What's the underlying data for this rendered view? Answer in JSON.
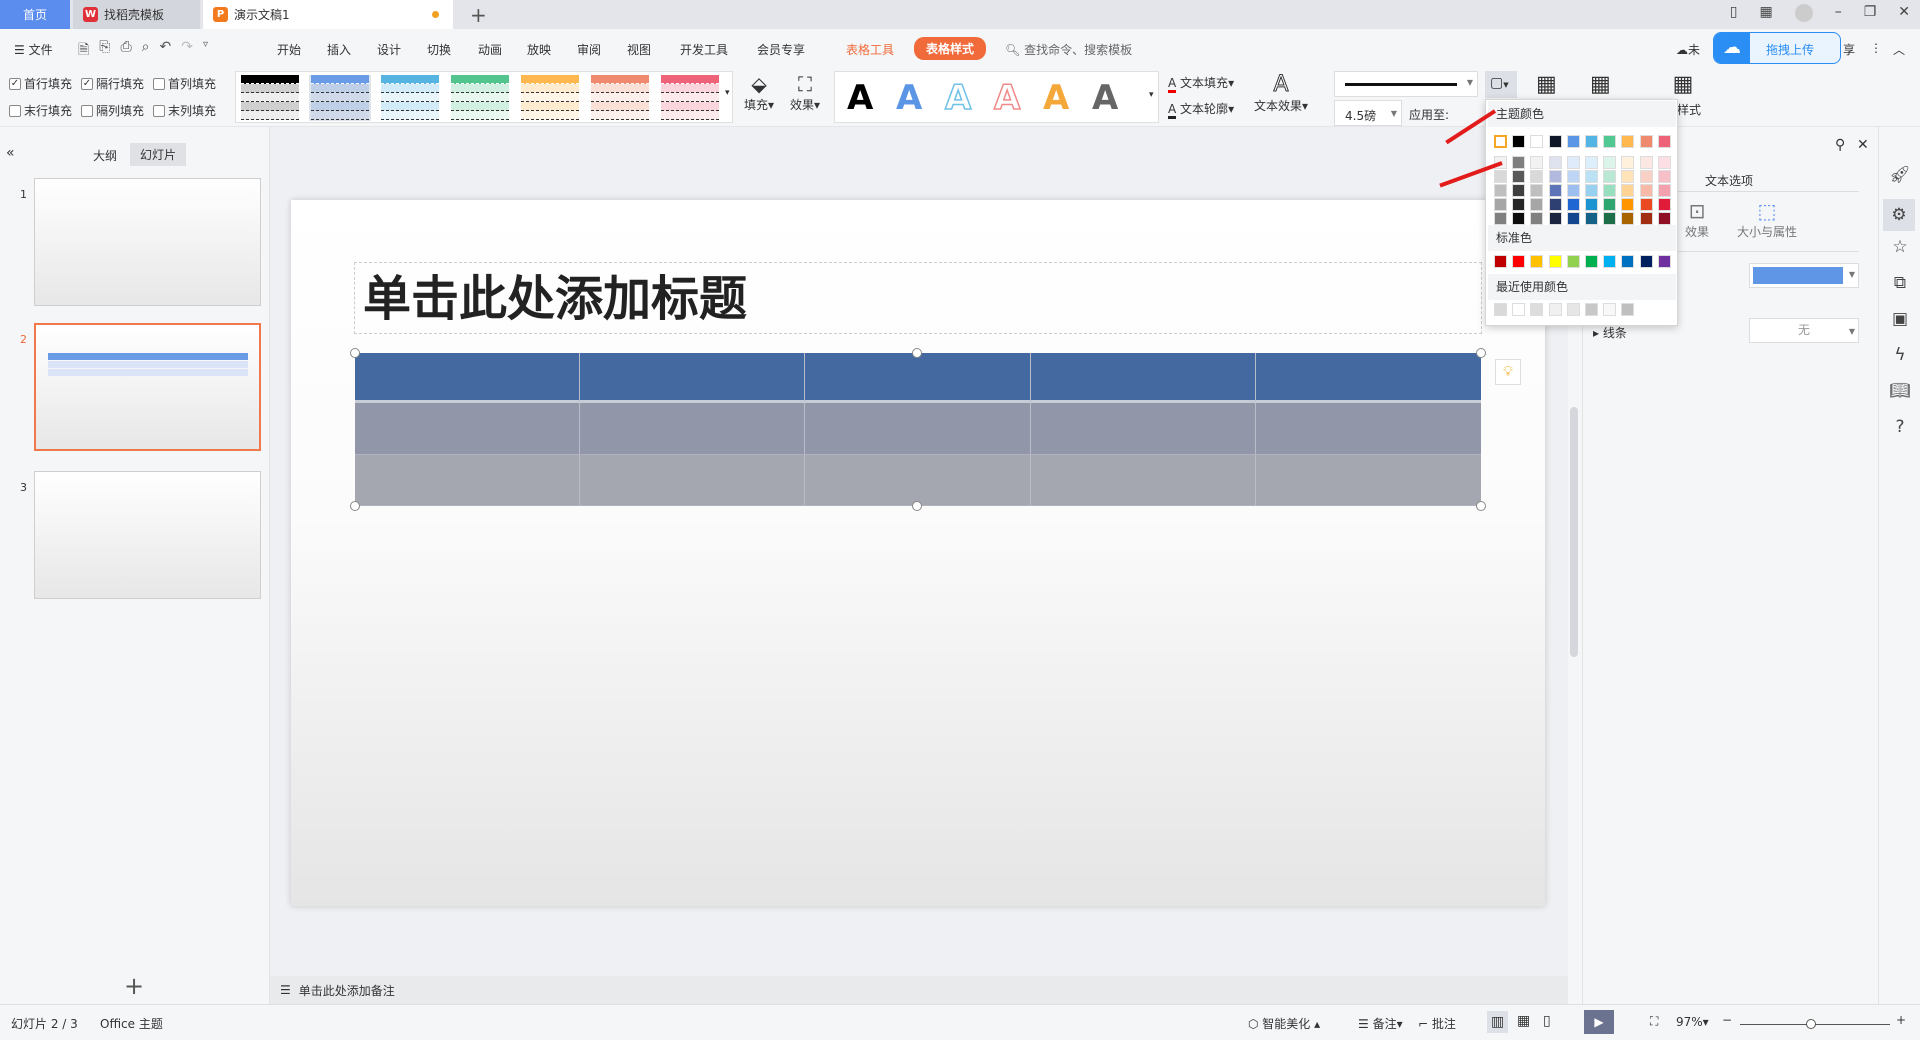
{
  "tabs": [
    {
      "label": "首页",
      "active": false
    },
    {
      "label": "找稻壳模板",
      "icon": "docer-icon"
    },
    {
      "label": "演示文稿1",
      "icon": "presentation-icon",
      "active": true
    }
  ],
  "menu": {
    "file": "文件",
    "items": [
      "开始",
      "插入",
      "设计",
      "切换",
      "动画",
      "放映",
      "审阅",
      "视图",
      "开发工具",
      "会员专享"
    ],
    "table_tools": "表格工具",
    "table_style": "表格样式",
    "search_placeholder": "查找命令、搜索模板",
    "cloud_status": "未",
    "upload": "拖拽上传",
    "share_tail": "享"
  },
  "ribbon": {
    "checkboxes": [
      {
        "label": "首行填充",
        "checked": true
      },
      {
        "label": "隔行填充",
        "checked": true
      },
      {
        "label": "首列填充",
        "checked": false
      },
      {
        "label": "末行填充",
        "checked": false
      },
      {
        "label": "隔列填充",
        "checked": false
      },
      {
        "label": "末列填充",
        "checked": false
      }
    ],
    "table_style_colors": [
      "#000000",
      "#6a9be6",
      "#56b4e3",
      "#52c58f",
      "#ffb84f",
      "#f08a6e",
      "#ee6377"
    ],
    "fill": "填充",
    "effect": "效果",
    "text_style_colors": [
      "#000000",
      "#5b95e6",
      "#6fc0e8",
      "#f08a8a",
      "#f5a83a",
      "#666666"
    ],
    "text_fill": "文本填充",
    "text_outline": "文本轮廓",
    "text_effect": "文本效果",
    "line_width": "4.5磅",
    "apply_to": "应用至:",
    "erase_style": "格样式"
  },
  "color_popup": {
    "theme_label": "主题颜色",
    "theme_colors": [
      "#FFFFFF",
      "#000000",
      "#FFFFFF",
      "#0E1628",
      "#5B95E6",
      "#54B5E4",
      "#52C993",
      "#FFB84F",
      "#F08A6E",
      "#EE6377"
    ],
    "shades": [
      [
        "#f2f2f2",
        "#d9d9d9",
        "#bfbfbf",
        "#a6a6a6",
        "#808080"
      ],
      [
        "#7f7f7f",
        "#595959",
        "#3f3f3f",
        "#262626",
        "#0d0d0d"
      ],
      [
        "#f2f2f2",
        "#d9d9d9",
        "#bfbfbf",
        "#a6a6a6",
        "#808080"
      ],
      [
        "#dfe3f0",
        "#b1bade",
        "#5e74b8",
        "#2e3f72",
        "#1c2540"
      ],
      [
        "#dfeafb",
        "#bfd5f5",
        "#9dbfef",
        "#1f66d2",
        "#144690"
      ],
      [
        "#ddeffa",
        "#bbe1f4",
        "#98d1ef",
        "#1d94d2",
        "#156187"
      ],
      [
        "#dcf4e9",
        "#b9e9d4",
        "#97dfbe",
        "#2fa56f",
        "#1f6e4a"
      ],
      [
        "#fff1dc",
        "#ffe3b9",
        "#ffd495",
        "#ff9500",
        "#a86400"
      ],
      [
        "#fce8e2",
        "#f9d0c5",
        "#f7b9a8",
        "#ea4a22",
        "#a12e12"
      ],
      [
        "#fbdfe4",
        "#f7bfc8",
        "#f4a0ae",
        "#e11b3a",
        "#8f1024"
      ]
    ],
    "standard_label": "标准色",
    "standard_colors": [
      "#C00000",
      "#FF0000",
      "#FFC000",
      "#FFFF00",
      "#92D050",
      "#00B050",
      "#00B0F0",
      "#0070C0",
      "#002060",
      "#7030A0"
    ],
    "recent_label": "最近使用颜色",
    "recent_colors": [
      "#d9d9d9",
      "#ffffff",
      "#dddddd",
      "#f0f0f0",
      "#e6e6e6",
      "#c8c8c8",
      "#f8f8f8",
      "#bfbfbf"
    ]
  },
  "left_panel": {
    "outline_tab": "大纲",
    "slides_tab": "幻灯片",
    "slides": [
      "1",
      "2",
      "3"
    ],
    "selected": 2
  },
  "slide": {
    "title_placeholder": "单击此处添加标题",
    "header_color": "#4469a0",
    "row1_color": "#9196a8",
    "row2_color": "#a4a6b0"
  },
  "notes_placeholder": "单击此处添加备注",
  "right_panel": {
    "text_options": "文本选项",
    "effect": "效果",
    "size_props": "大小与属性",
    "fill_color": "#6096e6",
    "line_label": "线条",
    "line_value": "无"
  },
  "status": {
    "slide_info": "幻灯片 2 / 3",
    "theme": "Office 主题",
    "beautify": "智能美化",
    "notes": "备注",
    "comments": "批注",
    "zoom": "97%"
  }
}
